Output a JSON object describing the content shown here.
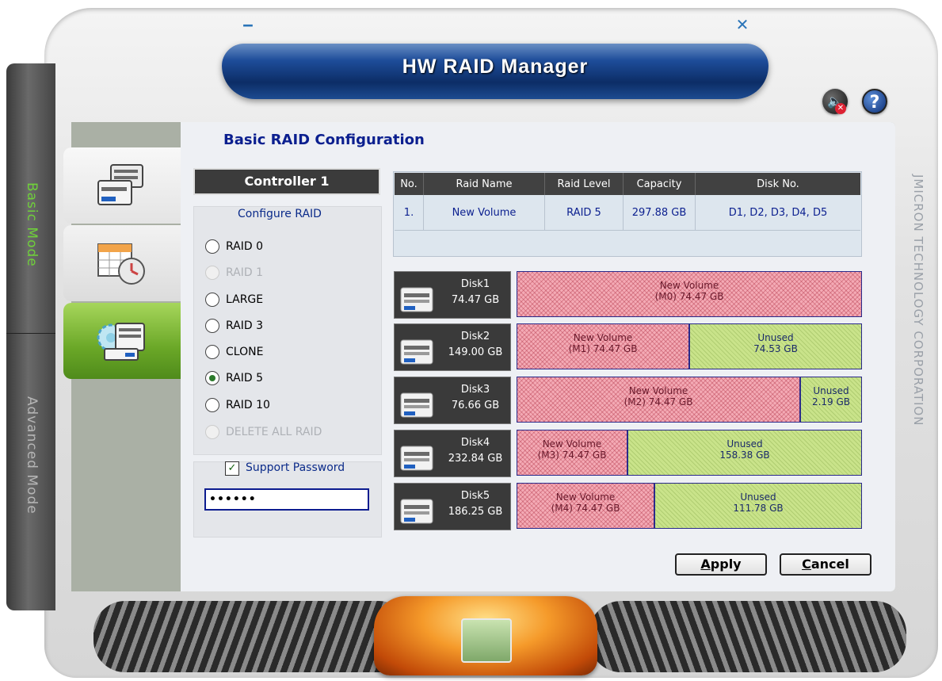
{
  "window": {
    "title": "HW RAID Manager",
    "minimize_glyph": "‒",
    "close_glyph": "✕",
    "help_glyph": "?",
    "sound_glyph": "🔈",
    "mute_glyph": "✕",
    "vendor": "JMICRON TECHNOLOGY CORPORATION"
  },
  "modes": {
    "basic": "Basic Mode",
    "advanced": "Advanced Mode"
  },
  "page": {
    "heading": "Basic RAID Configuration"
  },
  "controller": {
    "label": "Controller 1"
  },
  "configure": {
    "title": "Configure RAID",
    "options": [
      {
        "label": "RAID 0",
        "enabled": true,
        "selected": false
      },
      {
        "label": "RAID 1",
        "enabled": false,
        "selected": false
      },
      {
        "label": "LARGE",
        "enabled": true,
        "selected": false
      },
      {
        "label": "RAID 3",
        "enabled": true,
        "selected": false
      },
      {
        "label": "CLONE",
        "enabled": true,
        "selected": false
      },
      {
        "label": "RAID 5",
        "enabled": true,
        "selected": true
      },
      {
        "label": "RAID 10",
        "enabled": true,
        "selected": false
      },
      {
        "label": "DELETE ALL RAID",
        "enabled": false,
        "selected": false
      }
    ]
  },
  "password": {
    "label": "Support Password",
    "checked": true,
    "check_glyph": "✓",
    "value": "••••••"
  },
  "table": {
    "headers": [
      "No.",
      "Raid Name",
      "Raid Level",
      "Capacity",
      "Disk No."
    ],
    "rows": [
      [
        "1.",
        "New Volume",
        "RAID 5",
        "297.88 GB",
        "D1, D2, D3, D4, D5"
      ]
    ]
  },
  "disks": [
    {
      "name": "Disk1",
      "size": "74.47 GB",
      "segments": [
        {
          "type": "volume",
          "line1": "New Volume",
          "line2": "(M0) 74.47 GB",
          "fraction": 1.0
        }
      ]
    },
    {
      "name": "Disk2",
      "size": "149.00 GB",
      "segments": [
        {
          "type": "volume",
          "line1": "New Volume",
          "line2": "(M1) 74.47 GB",
          "fraction": 0.5
        },
        {
          "type": "unused",
          "line1": "Unused",
          "line2": "74.53 GB",
          "fraction": 0.5
        }
      ]
    },
    {
      "name": "Disk3",
      "size": "76.66 GB",
      "segments": [
        {
          "type": "volume",
          "line1": "New Volume",
          "line2": "(M2) 74.47 GB",
          "fraction": 0.82
        },
        {
          "type": "unused",
          "line1": "Unused",
          "line2": "2.19 GB",
          "fraction": 0.18
        }
      ]
    },
    {
      "name": "Disk4",
      "size": "232.84 GB",
      "segments": [
        {
          "type": "volume",
          "line1": "New Volume",
          "line2": "(M3) 74.47 GB",
          "fraction": 0.32
        },
        {
          "type": "unused",
          "line1": "Unused",
          "line2": "158.38 GB",
          "fraction": 0.68
        }
      ]
    },
    {
      "name": "Disk5",
      "size": "186.25 GB",
      "segments": [
        {
          "type": "volume",
          "line1": "New Volume",
          "line2": "(M4) 74.47 GB",
          "fraction": 0.4
        },
        {
          "type": "unused",
          "line1": "Unused",
          "line2": "111.78 GB",
          "fraction": 0.6
        }
      ]
    }
  ],
  "buttons": {
    "apply": "Apply",
    "cancel": "Cancel"
  },
  "colors": {
    "accent_blue": "#0b1f8f",
    "volume_pink": "#f4aab5",
    "unused_green": "#c9e38a",
    "active_tab_green": "#6aa727"
  }
}
